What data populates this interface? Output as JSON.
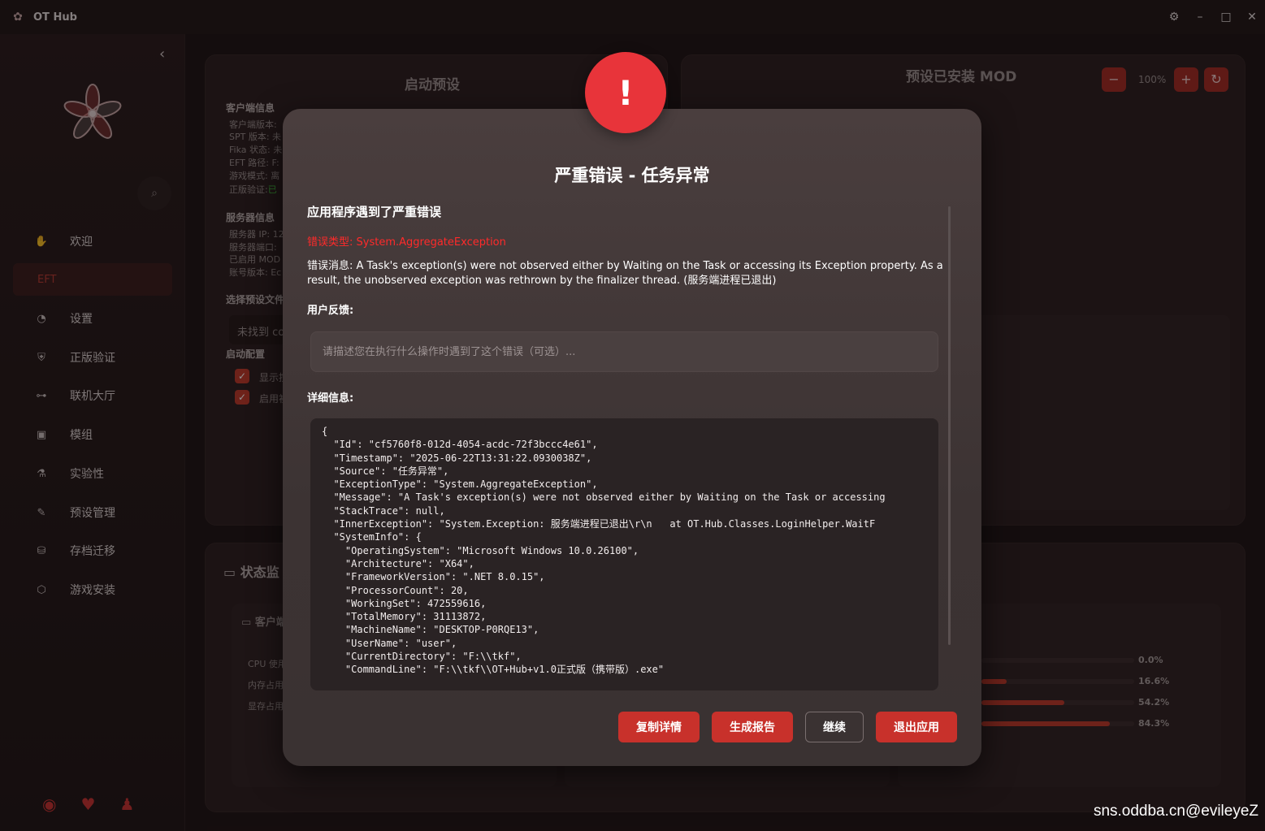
{
  "window": {
    "title": "OT Hub",
    "controls": [
      "⚙",
      "–",
      "□",
      "✕"
    ]
  },
  "sidebar": {
    "items": [
      {
        "label": "欢迎",
        "icon": "hand-icon",
        "glyph": "✋"
      },
      {
        "label": "EFT",
        "icon": "",
        "glyph": ""
      },
      {
        "label": "设置",
        "icon": "palette-icon",
        "glyph": "◔"
      },
      {
        "label": "正版验证",
        "icon": "shield-icon",
        "glyph": "⛨"
      },
      {
        "label": "联机大厅",
        "icon": "gamepad-icon",
        "glyph": "⊶"
      },
      {
        "label": "模组",
        "icon": "box-icon",
        "glyph": "▣"
      },
      {
        "label": "实验性",
        "icon": "flask-icon",
        "glyph": "⚗"
      },
      {
        "label": "预设管理",
        "icon": "brush-icon",
        "glyph": "✎"
      },
      {
        "label": "存档迁移",
        "icon": "database-icon",
        "glyph": "⛁"
      },
      {
        "label": "游戏安装",
        "icon": "cube-icon",
        "glyph": "⬡"
      }
    ],
    "footer_icons": [
      "github-icon",
      "bulb-icon",
      "qq-icon"
    ]
  },
  "launch_panel": {
    "title": "启动预设",
    "client_section": "客户端信息",
    "client_lines": [
      "客户端版本:",
      "SPT 版本: 未",
      "Fika 状态: 未",
      "EFT 路径: F:",
      "游戏模式: 离",
      "正版验证:"
    ],
    "client_ok": "已",
    "server_section": "服务器信息",
    "server_lines": [
      "服务器 IP: 12",
      "服务器端口:",
      "已启用 MOD",
      "账号版本: Ec"
    ],
    "preset_section": "选择预设文件",
    "preset_value": "未找到 co",
    "config_section": "启动配置",
    "checks": [
      "显示控",
      "启用初"
    ]
  },
  "mods_panel": {
    "title": "预设已安装 MOD",
    "zoom": "100%"
  },
  "status_panel": {
    "title": "状态监",
    "card_title": "客户端",
    "rows": [
      "CPU 使用",
      "内存占用",
      "显存占用"
    ],
    "bars": [
      {
        "pct": "0.0%",
        "fill": 0
      },
      {
        "pct": "16.6%",
        "fill": 0.166
      },
      {
        "pct": "54.2%",
        "fill": 0.542
      },
      {
        "pct": "84.3%",
        "fill": 0.843
      }
    ]
  },
  "dialog": {
    "icon": "!",
    "title": "严重错误 - 任务异常",
    "heading": "应用程序遇到了严重错误",
    "error_type": "错误类型: System.AggregateException",
    "error_message": "错误消息: A Task's exception(s) were not observed either by Waiting on the Task or accessing its Exception property. As a result, the unobserved exception was rethrown by the finalizer thread. (服务端进程已退出)",
    "feedback_label": "用户反馈:",
    "feedback_placeholder": "请描述您在执行什么操作时遇到了这个错误（可选）...",
    "details_label": "详细信息:",
    "details_text": "{\n  \"Id\": \"cf5760f8-012d-4054-acdc-72f3bccc4e61\",\n  \"Timestamp\": \"2025-06-22T13:31:22.0930038Z\",\n  \"Source\": \"任务异常\",\n  \"ExceptionType\": \"System.AggregateException\",\n  \"Message\": \"A Task's exception(s) were not observed either by Waiting on the Task or accessing\n  \"StackTrace\": null,\n  \"InnerException\": \"System.Exception: 服务端进程已退出\\r\\n   at OT.Hub.Classes.LoginHelper.WaitF\n  \"SystemInfo\": {\n    \"OperatingSystem\": \"Microsoft Windows 10.0.26100\",\n    \"Architecture\": \"X64\",\n    \"FrameworkVersion\": \".NET 8.0.15\",\n    \"ProcessorCount\": 20,\n    \"WorkingSet\": 472559616,\n    \"TotalMemory\": 31113872,\n    \"MachineName\": \"DESKTOP-P0RQE13\",\n    \"UserName\": \"user\",\n    \"CurrentDirectory\": \"F:\\\\tkf\",\n    \"CommandLine\": \"F:\\\\tkf\\\\OT+Hub+v1.0正式版（携带版）.exe\"",
    "buttons": {
      "copy": "复制详情",
      "report": "生成报告",
      "continue": "继续",
      "exit": "退出应用"
    }
  },
  "watermark": "sns.oddba.cn@evileyeZ"
}
